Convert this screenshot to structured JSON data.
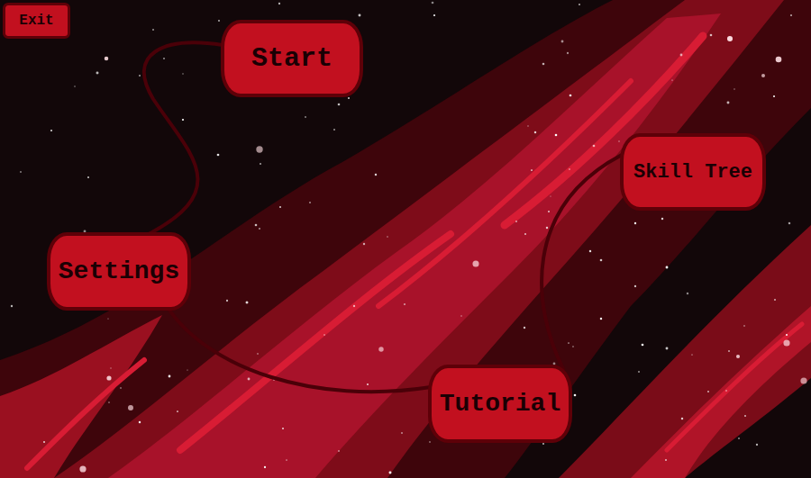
{
  "exit_button": {
    "label": "Exit"
  },
  "menu": [
    {
      "label": "Start"
    },
    {
      "label": "Settings"
    },
    {
      "label": "Tutorial"
    },
    {
      "label": "Skill Tree"
    }
  ]
}
